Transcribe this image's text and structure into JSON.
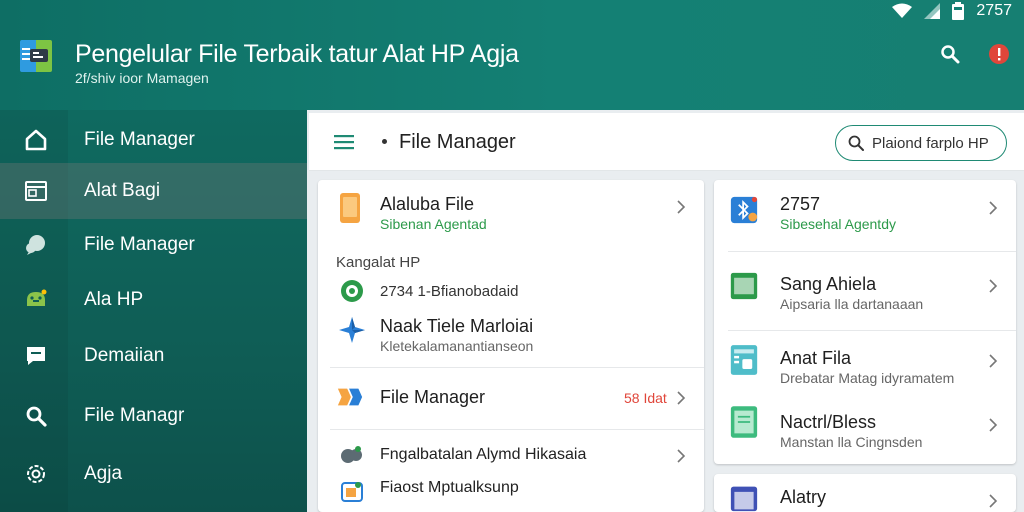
{
  "status": {
    "time": "2757"
  },
  "app": {
    "title": "Pengelular File Terbaik tatur Alat HP Agja",
    "subtitle": "2f/shiv ioor Mamagen"
  },
  "sidebar": {
    "items": [
      {
        "label": "File Manager",
        "icon": "home-icon"
      },
      {
        "label": "Alat Bagi",
        "icon": "window-icon",
        "selected": true
      },
      {
        "label": "File Manager",
        "icon": "chat-icon"
      },
      {
        "label": "Ala HP",
        "icon": "android-icon"
      },
      {
        "label": "Demaiian",
        "icon": "message-icon"
      },
      {
        "label": "File Managr",
        "icon": "search-icon"
      },
      {
        "label": "Agja",
        "icon": "settings-icon"
      }
    ]
  },
  "header": {
    "title": "File Manager",
    "search_label": "Plaiond farplo HP"
  },
  "left_card": {
    "top": {
      "title": "Alaluba File",
      "subtitle": "Sibenan Agentad"
    },
    "section_label": "Kangalat HP",
    "item1": {
      "title": "2734 1-Bfianobadaid"
    },
    "item2": {
      "title": "Naak Tiele Marloiai",
      "subtitle": "Kletekalamanantianseon"
    },
    "file_manager": {
      "title": "File Manager",
      "badge": "58 Idat"
    },
    "bottom1": {
      "title": "Fngalbatalan Alymd Hikasaia"
    },
    "bottom2": {
      "title": "Fiaost Mptualksunp"
    }
  },
  "right_card": {
    "item1": {
      "title": "2757",
      "subtitle": "Sibesehal Agentdy"
    },
    "item2": {
      "title": "Sang Ahiela",
      "subtitle": "Aipsaria lla dartanaaan"
    },
    "item3": {
      "title": "Anat Fila",
      "subtitle": "Drebatar Matag idyramatem"
    },
    "item4": {
      "title": "Nactrl/Bless",
      "subtitle": "Manstan lla Cingnsden"
    },
    "item5": {
      "title": "Alatry"
    }
  },
  "colors": {
    "primary": "#148074",
    "accent_green": "#2c9a4a",
    "alert_red": "#e0463a"
  }
}
